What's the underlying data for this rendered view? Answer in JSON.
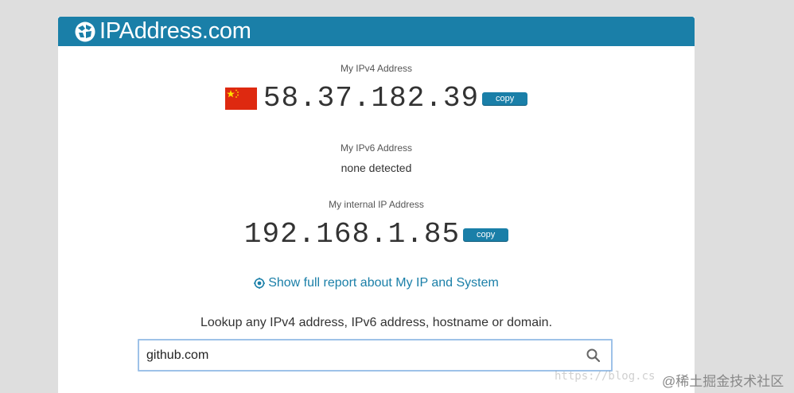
{
  "header": {
    "title": "IPAddress.com"
  },
  "ipv4": {
    "label": "My IPv4 Address",
    "value": "58.37.182.39",
    "copy_label": "copy"
  },
  "ipv6": {
    "label": "My IPv6 Address",
    "value": "none detected"
  },
  "internal": {
    "label": "My internal IP Address",
    "value": "192.168.1.85",
    "copy_label": "copy"
  },
  "report": {
    "label": "Show full report about My IP and System"
  },
  "lookup": {
    "prompt": "Lookup any IPv4 address, IPv6 address, hostname or domain.",
    "value": "github.com"
  },
  "watermark": {
    "url_text": "https://blog.cs",
    "community": "@稀土掘金技术社区"
  },
  "colors": {
    "brand": "#1a7fa8",
    "flag_red": "#de2910",
    "flag_star": "#ffde00"
  }
}
